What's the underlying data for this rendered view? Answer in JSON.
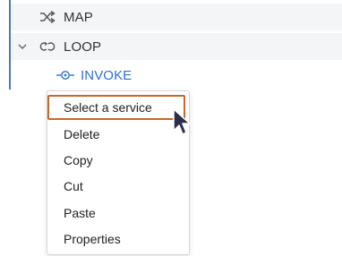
{
  "tree": {
    "items": [
      {
        "label": "MAP",
        "icon": "shuffle-icon"
      },
      {
        "label": "LOOP",
        "icon": "loop-icon",
        "expanded": true
      },
      {
        "label": "INVOKE",
        "icon": "invoke-icon"
      }
    ]
  },
  "context_menu": {
    "items": [
      {
        "label": "Select a service",
        "highlighted": true
      },
      {
        "label": "Delete"
      },
      {
        "label": "Copy"
      },
      {
        "label": "Cut"
      },
      {
        "label": "Paste"
      },
      {
        "label": "Properties"
      }
    ]
  },
  "colors": {
    "accent_border": "#4a78c2",
    "link": "#2f6fd8",
    "highlight": "#c8672a",
    "cursor": "#2b2f4a"
  }
}
